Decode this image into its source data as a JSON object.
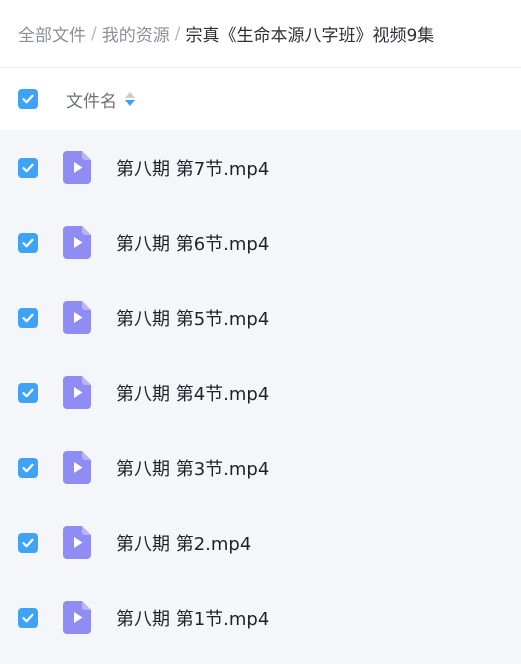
{
  "breadcrumb": {
    "items": [
      {
        "label": "全部文件"
      },
      {
        "label": "我的资源"
      }
    ],
    "separator": "/",
    "current": "宗真《生命本源八字班》视频9集"
  },
  "table_header": {
    "select_all_checked": true,
    "column_label": "文件名",
    "sort_icon": "sort-icon"
  },
  "files": [
    {
      "name": "第八期 第7节.mp4",
      "checked": true,
      "icon": "video-file-icon"
    },
    {
      "name": "第八期 第6节.mp4",
      "checked": true,
      "icon": "video-file-icon"
    },
    {
      "name": "第八期 第5节.mp4",
      "checked": true,
      "icon": "video-file-icon"
    },
    {
      "name": "第八期 第4节.mp4",
      "checked": true,
      "icon": "video-file-icon"
    },
    {
      "name": "第八期 第3节.mp4",
      "checked": true,
      "icon": "video-file-icon"
    },
    {
      "name": "第八期 第2.mp4",
      "checked": true,
      "icon": "video-file-icon"
    },
    {
      "name": "第八期 第1节.mp4",
      "checked": true,
      "icon": "video-file-icon"
    }
  ],
  "colors": {
    "checkbox": "#3ea2f5",
    "file_icon": "#8f8cf3",
    "list_background": "#f5f6fa"
  }
}
